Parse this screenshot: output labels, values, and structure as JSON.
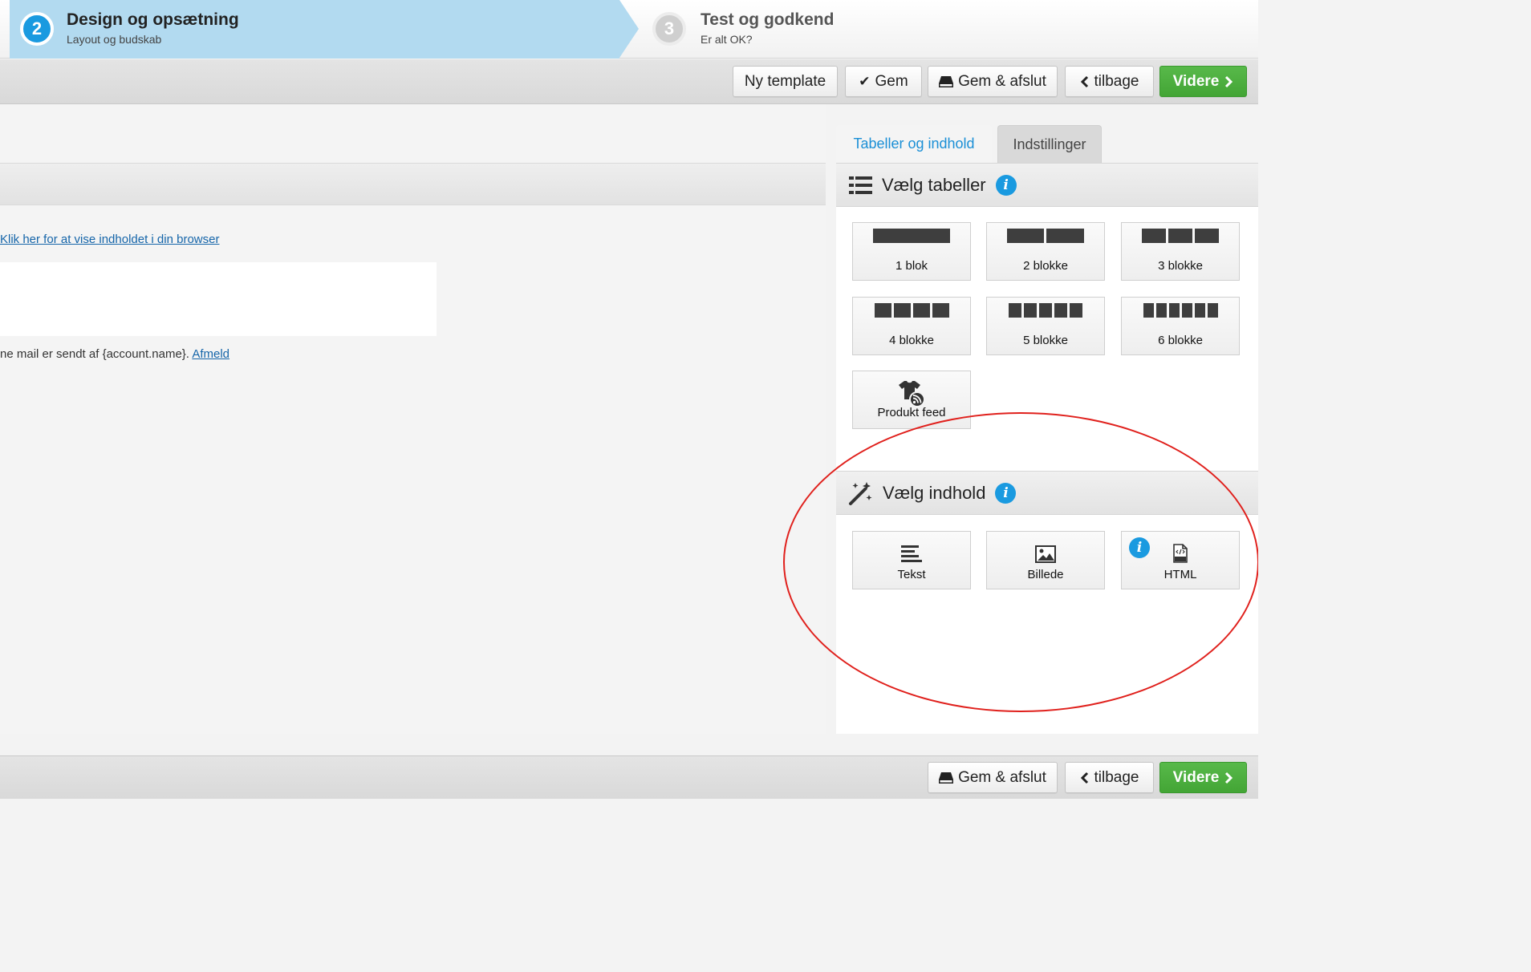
{
  "steps": [
    {
      "number": "2",
      "title": "Design og opsætning",
      "subtitle": "Layout og budskab"
    },
    {
      "number": "3",
      "title": "Test og godkend",
      "subtitle": "Er alt OK?"
    }
  ],
  "toolbar_top": {
    "new_template": "Ny template",
    "save": "Gem",
    "save_exit": "Gem & afslut",
    "back": "tilbage",
    "next": "Videre"
  },
  "toolbar_bottom": {
    "save_exit": "Gem & afslut",
    "back": "tilbage",
    "next": "Videre"
  },
  "canvas": {
    "browser_link": "Klik her for at vise indholdet i din browser",
    "footer_text": "ne mail er sendt af {account.name}.",
    "unsubscribe": "Afmeld"
  },
  "tabs": {
    "tables_content": "Tabeller og indhold",
    "settings": "Indstillinger"
  },
  "tables_section": {
    "title": "Vælg tabeller",
    "tiles": [
      {
        "label": "1 blok",
        "blocks": 1
      },
      {
        "label": "2 blokke",
        "blocks": 2
      },
      {
        "label": "3 blokke",
        "blocks": 3
      },
      {
        "label": "4 blokke",
        "blocks": 4
      },
      {
        "label": "5 blokke",
        "blocks": 5
      },
      {
        "label": "6 blokke",
        "blocks": 6
      },
      {
        "label": "Produkt feed",
        "icon": "tshirt-rss-icon"
      }
    ]
  },
  "content_section": {
    "title": "Vælg indhold",
    "tiles": [
      {
        "label": "Tekst",
        "icon": "text-lines-icon"
      },
      {
        "label": "Billede",
        "icon": "image-icon"
      },
      {
        "label": "HTML",
        "icon": "html-file-icon"
      }
    ]
  },
  "colors": {
    "accent_blue": "#1a9ae0",
    "active_step_bg": "#b2daf0",
    "green_button": "#4cae3f",
    "annotation_red": "#e0201c"
  }
}
